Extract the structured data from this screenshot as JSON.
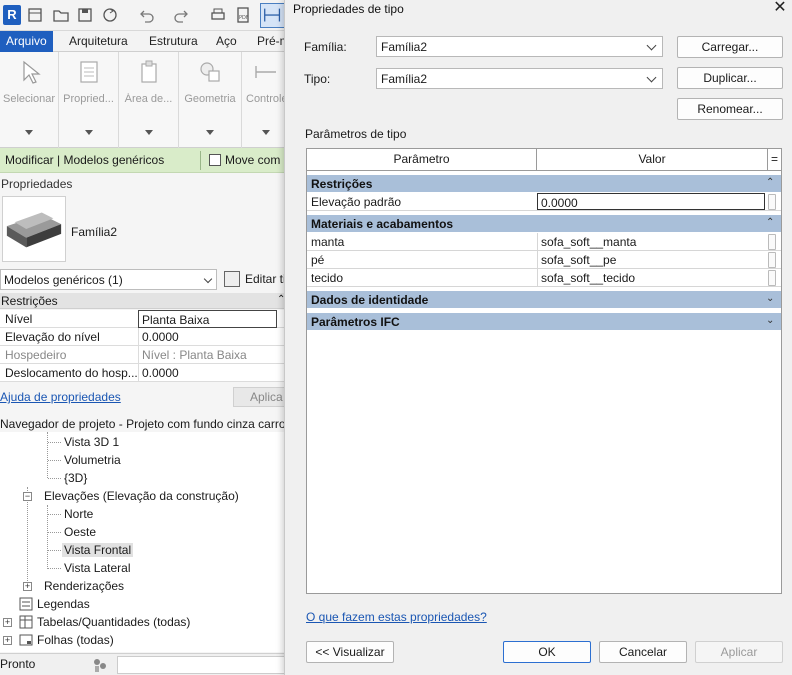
{
  "revit": {
    "logo": "R",
    "ribbon_tabs": [
      "Arquivo",
      "Arquitetura",
      "Estrutura",
      "Aço",
      "Pré-m"
    ],
    "ribbon_buttons": [
      "Selecionar",
      "Propried...",
      "Área de...",
      "Geometria",
      "Controle"
    ],
    "modify_bar": {
      "context": "Modificar | Modelos genéricos",
      "move_with": "Move com"
    },
    "properties": {
      "header": "Propriedades",
      "family_name": "Família2",
      "selector": "Modelos genéricos (1)",
      "edit_type": "Editar ti",
      "section": "Restrições",
      "rows": [
        {
          "key": "Nível",
          "value": "Planta Baixa"
        },
        {
          "key": "Elevação do nível",
          "value": "0.0000"
        },
        {
          "key": "Hospedeiro",
          "value": "Nível : Planta Baixa"
        },
        {
          "key": "Deslocamento do hosp...",
          "value": "0.0000"
        }
      ],
      "help_link": "Ajuda de propriedades",
      "apply": "Aplica"
    },
    "browser": {
      "title": "Navegador de projeto - Projeto com fundo cinza carro",
      "items": [
        {
          "label": "Vista 3D 1"
        },
        {
          "label": "Volumetria"
        },
        {
          "label": "{3D}"
        },
        {
          "label": "Elevações (Elevação da construção)"
        },
        {
          "label": "Norte"
        },
        {
          "label": "Oeste"
        },
        {
          "label": "Vista Frontal"
        },
        {
          "label": "Vista Lateral"
        },
        {
          "label": "Renderizações"
        },
        {
          "label": "Legendas"
        },
        {
          "label": "Tabelas/Quantidades (todas)"
        },
        {
          "label": "Folhas (todas)"
        }
      ]
    },
    "status": "Pronto"
  },
  "dialog": {
    "title": "Propriedades de tipo",
    "family_label": "Família:",
    "family_value": "Família2",
    "type_label": "Tipo:",
    "type_value": "Família2",
    "buttons": {
      "load": "Carregar...",
      "duplicate": "Duplicar...",
      "rename": "Renomear..."
    },
    "type_params_label": "Parâmetros de tipo",
    "grid": {
      "col_param": "Parâmetro",
      "col_value": "Valor",
      "col_eq": "=",
      "groups": [
        {
          "name": "Restrições",
          "expanded": true,
          "rows": [
            {
              "param": "Elevação padrão",
              "value": "0.0000"
            }
          ]
        },
        {
          "name": "Materiais e acabamentos",
          "expanded": true,
          "rows": [
            {
              "param": "manta",
              "value": "sofa_soft__manta"
            },
            {
              "param": "pé",
              "value": "sofa_soft__pe"
            },
            {
              "param": "tecido",
              "value": "sofa_soft__tecido"
            }
          ]
        },
        {
          "name": "Dados de identidade",
          "expanded": false,
          "rows": []
        },
        {
          "name": "Parâmetros IFC",
          "expanded": false,
          "rows": []
        }
      ]
    },
    "help_link": "O que fazem estas propriedades?",
    "footer": {
      "preview": "<< Visualizar",
      "ok": "OK",
      "cancel": "Cancelar",
      "apply": "Aplicar"
    },
    "colors": {
      "group_header": "#a9bfd9",
      "accent": "#2c6fd1",
      "link": "#1a56b3"
    }
  }
}
